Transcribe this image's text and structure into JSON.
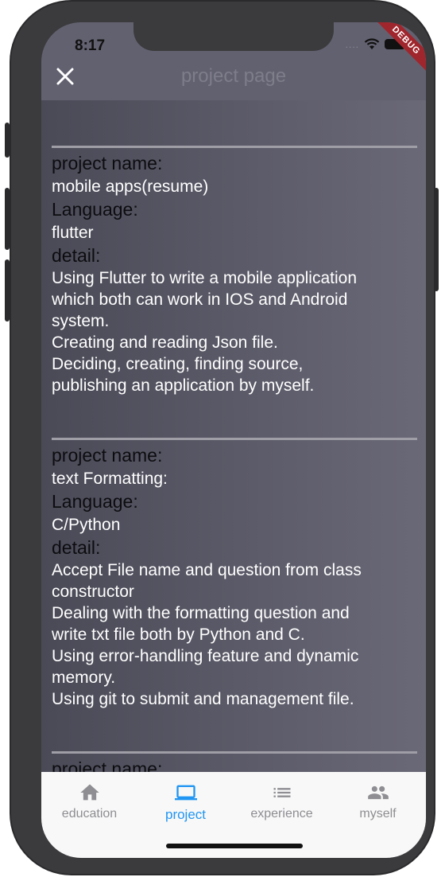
{
  "status_bar": {
    "time": "8:17"
  },
  "app_bar": {
    "title": "project page",
    "close_icon": "close-icon",
    "debug_banner": "DEBUG"
  },
  "projects": [
    {
      "name_label": "project name:",
      "name": "mobile apps(resume)",
      "language_label": "Language:",
      "language": "flutter",
      "detail_label": "detail:",
      "detail_lines": [
        "Using Flutter to write a mobile application",
        "which both can work in IOS and Android",
        "system.",
        "Creating and reading Json file.",
        "Deciding, creating, finding source,",
        "publishing an application by myself."
      ]
    },
    {
      "name_label": "project name:",
      "name": "text Formatting:",
      "language_label": "Language:",
      "language": "C/Python",
      "detail_label": "detail:",
      "detail_lines": [
        "Accept File name and question from class",
        "constructor",
        "Dealing with the formatting question and",
        "write txt file both by Python and C.",
        "Using error-handling feature and dynamic",
        "memory.",
        "Using git to submit and management file."
      ]
    },
    {
      "name_label": "project name:"
    }
  ],
  "bottom_nav": {
    "active_index": 1,
    "active_color": "#2196f3",
    "inactive_color": "#8e8e93",
    "items": [
      {
        "label": "education",
        "icon": "home-icon"
      },
      {
        "label": "project",
        "icon": "laptop-icon"
      },
      {
        "label": "experience",
        "icon": "list-icon"
      },
      {
        "label": "myself",
        "icon": "people-icon"
      }
    ]
  }
}
